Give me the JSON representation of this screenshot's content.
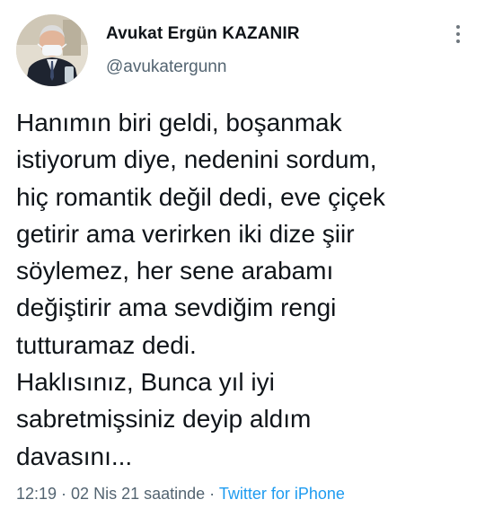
{
  "author": {
    "display_name": "Avukat Ergün KAZANIR",
    "handle": "@avukatergunn",
    "avatar_icon": "profile-photo"
  },
  "more_icon": "more-vertical-icon",
  "tweet": {
    "lines": [
      "Hanımın biri geldi, boşanmak",
      "istiyorum diye, nedenini sordum,",
      "hiç romantik değil dedi, eve çiçek",
      "getirir ama verirken iki dize şiir",
      "söylemez, her sene arabamı",
      "değiştirir ama sevdiğim rengi",
      "tutturamaz dedi.",
      "Haklısınız, Bunca yıl iyi",
      "sabretmişsiniz deyip aldım",
      "davasını..."
    ]
  },
  "meta": {
    "time": "12:19",
    "sep1": " · ",
    "date": "02 Nis 21 saatinde",
    "sep2": " · ",
    "source": "Twitter for iPhone"
  },
  "colors": {
    "text": "#0f1419",
    "secondary": "#536471",
    "link": "#1d9bf0"
  }
}
